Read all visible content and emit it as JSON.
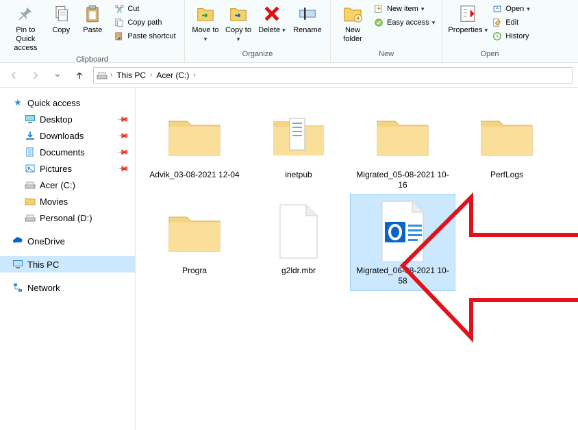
{
  "ribbon": {
    "clipboard": {
      "label": "Clipboard",
      "pin": "Pin to Quick access",
      "copy": "Copy",
      "paste": "Paste",
      "cut": "Cut",
      "copypath": "Copy path",
      "pasteshortcut": "Paste shortcut"
    },
    "organize": {
      "label": "Organize",
      "moveto": "Move to",
      "copyto": "Copy to",
      "delete": "Delete",
      "rename": "Rename"
    },
    "new": {
      "label": "New",
      "newfolder": "New folder",
      "newitem": "New item",
      "easyaccess": "Easy access"
    },
    "open": {
      "label": "Open",
      "properties": "Properties",
      "open": "Open",
      "edit": "Edit",
      "history": "History"
    }
  },
  "breadcrumb": {
    "thispc": "This PC",
    "drive": "Acer (C:)"
  },
  "sidebar": {
    "quickaccess": "Quick access",
    "desktop": "Desktop",
    "downloads": "Downloads",
    "documents": "Documents",
    "pictures": "Pictures",
    "acer": "Acer (C:)",
    "movies": "Movies",
    "personal": "Personal (D:)",
    "onedrive": "OneDrive",
    "thispc": "This PC",
    "network": "Network"
  },
  "items": [
    {
      "name": "Advik_03-08-2021 12-04",
      "type": "folder"
    },
    {
      "name": "inetpub",
      "type": "folder-docs"
    },
    {
      "name": "Migrated_05-08-2021 10-16",
      "type": "folder"
    },
    {
      "name": "PerfLogs",
      "type": "folder"
    },
    {
      "name": "Progra",
      "type": "folder"
    },
    {
      "name": "g2ldr.mbr",
      "type": "file"
    },
    {
      "name": "Migrated_06-08-2021 10-58",
      "type": "outlook",
      "selected": true
    }
  ]
}
